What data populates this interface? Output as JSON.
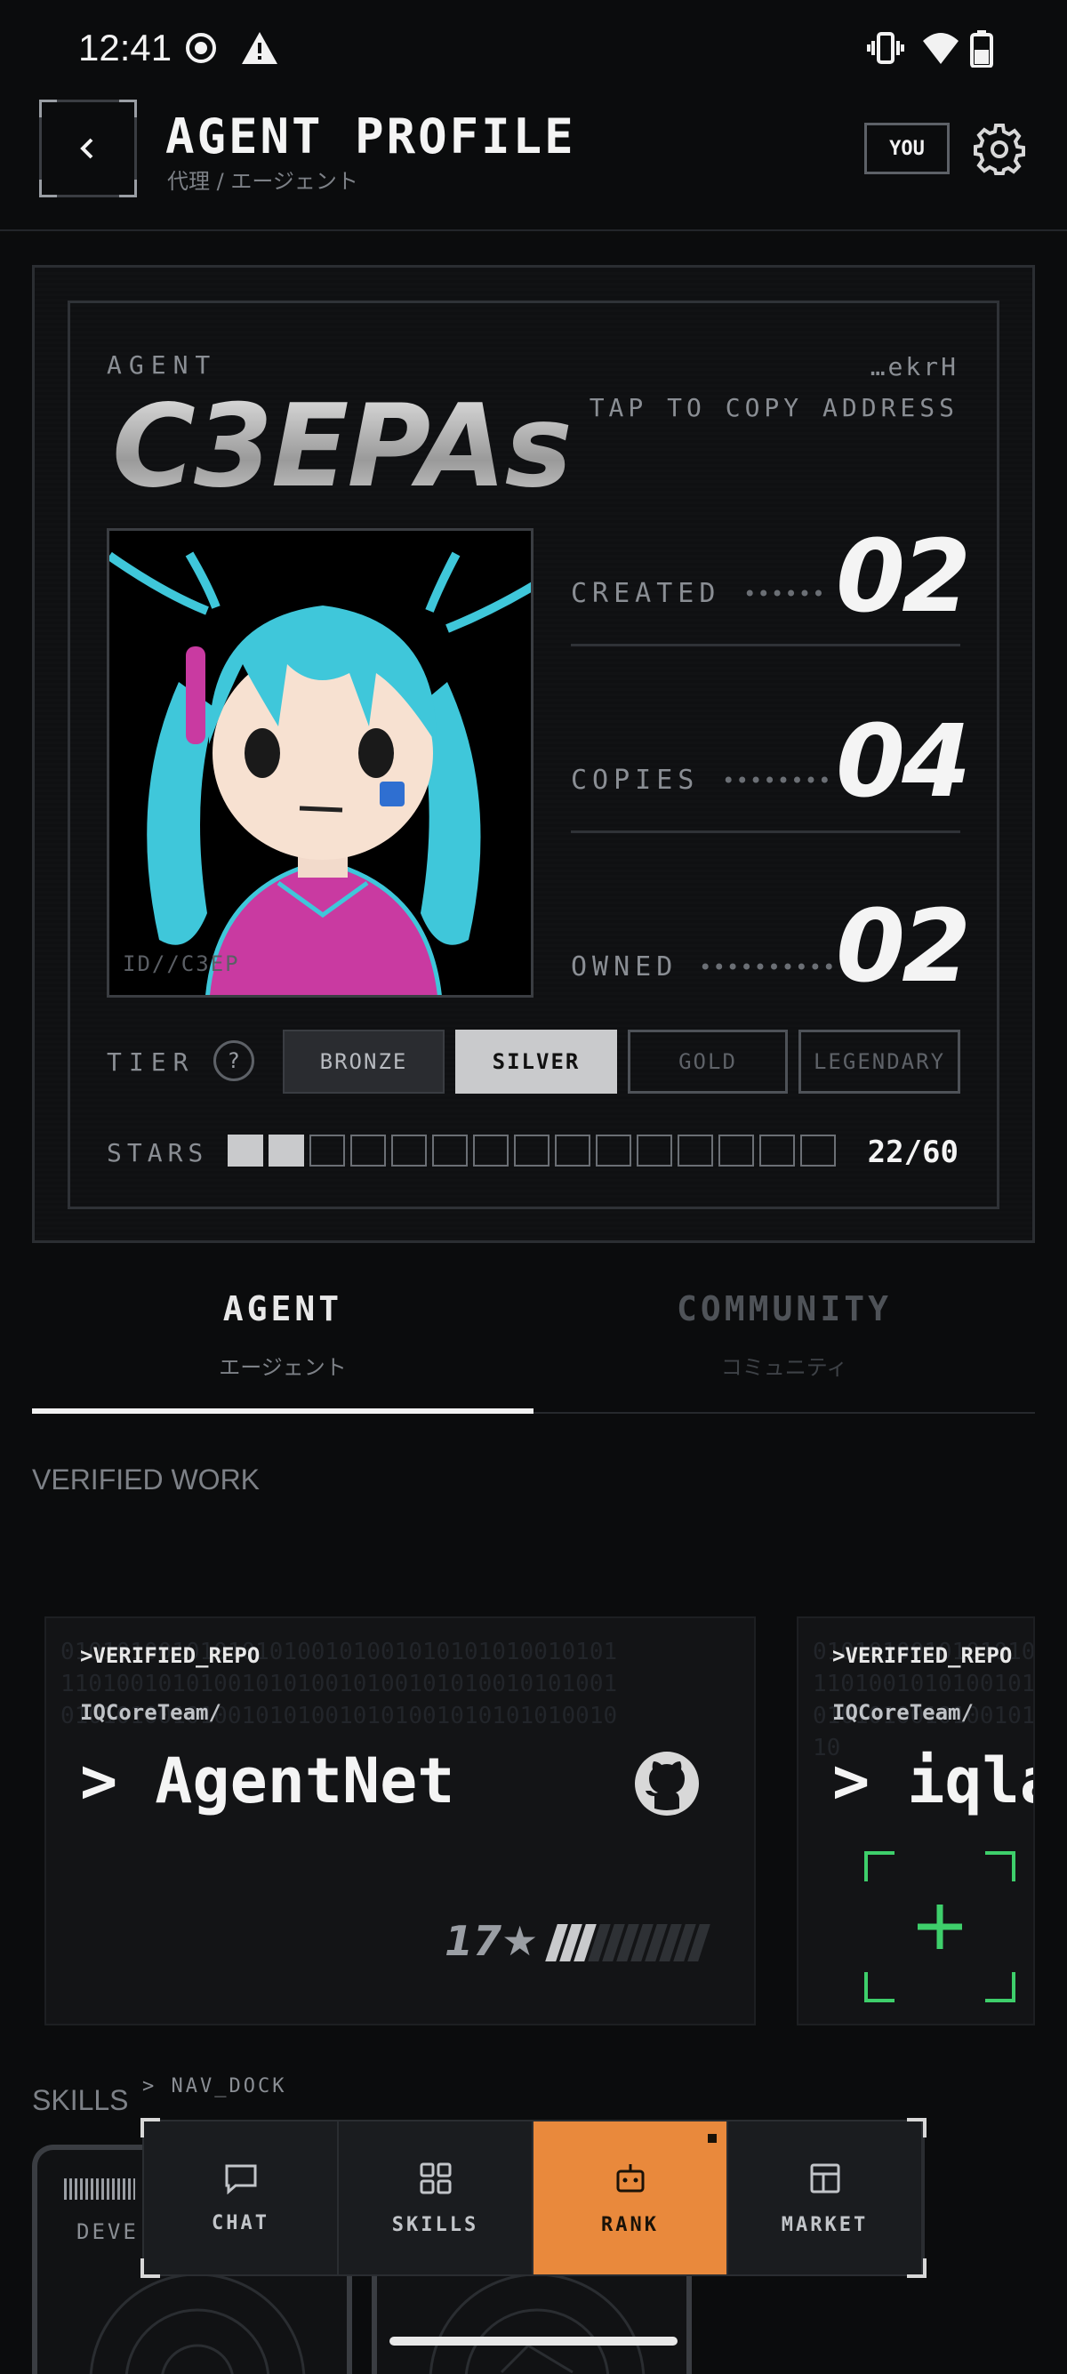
{
  "status_bar": {
    "time": "12:41"
  },
  "header": {
    "title": "AGENT PROFILE",
    "subtitle": "代理 / エージェント",
    "you_badge": "YOU"
  },
  "profile": {
    "agent_label": "AGENT",
    "agent_name": "C3EPAs",
    "address_short": "…ekrH",
    "tap_to_copy": "TAP TO COPY ADDRESS",
    "avatar_id": "ID//C3EP",
    "stats": [
      {
        "label": "CREATED",
        "dots": "••••••",
        "value": "02"
      },
      {
        "label": "COPIES",
        "dots": "••••••••",
        "value": "04"
      },
      {
        "label": "OWNED",
        "dots": "••••••••••",
        "value": "02"
      }
    ],
    "tier_label": "TIER",
    "tier_help": "?",
    "tiers": [
      "BRONZE",
      "SILVER",
      "GOLD",
      "LEGENDARY"
    ],
    "tier_selected": "SILVER",
    "stars_label": "STARS",
    "stars_text": "22/60",
    "stars_current": 22,
    "stars_max": 60,
    "stars_segments_total": 15,
    "stars_segments_filled": 2
  },
  "tabs": [
    {
      "label": "AGENT",
      "sub": "エージェント",
      "active": true
    },
    {
      "label": "COMMUNITY",
      "sub": "コミュニティ",
      "active": false
    }
  ],
  "verified_work": {
    "title": "VERIFIED WORK",
    "repos": [
      {
        "tag": ">VERIFIED_REPO",
        "owner": "IQCoreTeam/",
        "name": "> AgentNet",
        "stars": "17★",
        "icon": "github-icon"
      },
      {
        "tag": ">VERIFIED_REPO",
        "owner": "IQCoreTeam/",
        "name": "> iqla",
        "icon": "add-icon"
      }
    ]
  },
  "skills": {
    "title": "SKILLS",
    "card_label": "DEVE"
  },
  "nav_dock": {
    "label": "> NAV_DOCK",
    "items": [
      {
        "label": "CHAT",
        "icon": "chat-icon"
      },
      {
        "label": "SKILLS",
        "icon": "grid-icon"
      },
      {
        "label": "RANK",
        "icon": "robot-icon"
      },
      {
        "label": "MARKET",
        "icon": "market-icon"
      }
    ],
    "active": "RANK"
  },
  "colors": {
    "accent": "#e9893c",
    "silver": "#c9cacc",
    "background": "#0b0c0d",
    "add_green": "#3ecf6b"
  }
}
